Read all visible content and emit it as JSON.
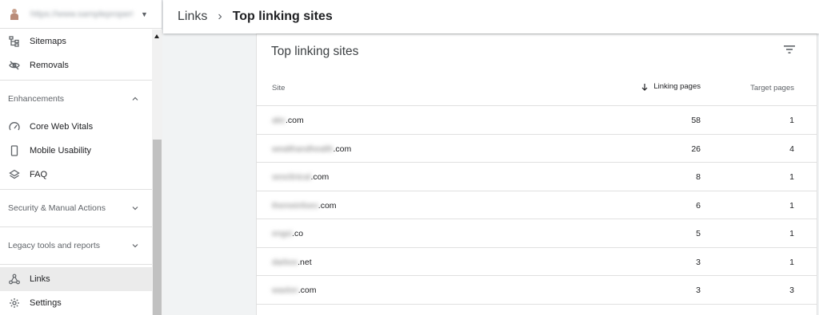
{
  "property": {
    "url": "https://www.sampleproperty.com/"
  },
  "sidebar": {
    "top_items": [
      {
        "label": "Sitemaps",
        "icon": "sitemap-icon"
      },
      {
        "label": "Removals",
        "icon": "eye-off-icon"
      }
    ],
    "enhancements": {
      "header": "Enhancements",
      "items": [
        {
          "label": "Core Web Vitals",
          "icon": "gauge-icon"
        },
        {
          "label": "Mobile Usability",
          "icon": "smartphone-icon"
        },
        {
          "label": "FAQ",
          "icon": "layers-icon"
        }
      ]
    },
    "security": {
      "header": "Security & Manual Actions"
    },
    "legacy": {
      "header": "Legacy tools and reports"
    },
    "bottom_items": [
      {
        "label": "Links",
        "icon": "hub-icon",
        "active": true
      },
      {
        "label": "Settings",
        "icon": "gear-icon"
      }
    ]
  },
  "header": {
    "breadcrumb_root": "Links",
    "breadcrumb_separator": "›",
    "breadcrumb_current": "Top linking sites"
  },
  "card": {
    "title": "Top linking sites",
    "columns": {
      "site": "Site",
      "linking": "Linking pages",
      "target": "Target pages"
    },
    "rows": [
      {
        "site_blur": "abc",
        "site_tld": ".com",
        "linking": "58",
        "target": "1"
      },
      {
        "site_blur": "wealthandhealth",
        "site_tld": ".com",
        "linking": "26",
        "target": "4"
      },
      {
        "site_blur": "seoclinical",
        "site_tld": ".com",
        "linking": "8",
        "target": "1"
      },
      {
        "site_blur": "themeinfoeo",
        "site_tld": ".com",
        "linking": "6",
        "target": "1"
      },
      {
        "site_blur": "engsi",
        "site_tld": ".co",
        "linking": "5",
        "target": "1"
      },
      {
        "site_blur": "darbos",
        "site_tld": ".net",
        "linking": "3",
        "target": "1"
      },
      {
        "site_blur": "waxlon",
        "site_tld": ".com",
        "linking": "3",
        "target": "3"
      }
    ]
  }
}
